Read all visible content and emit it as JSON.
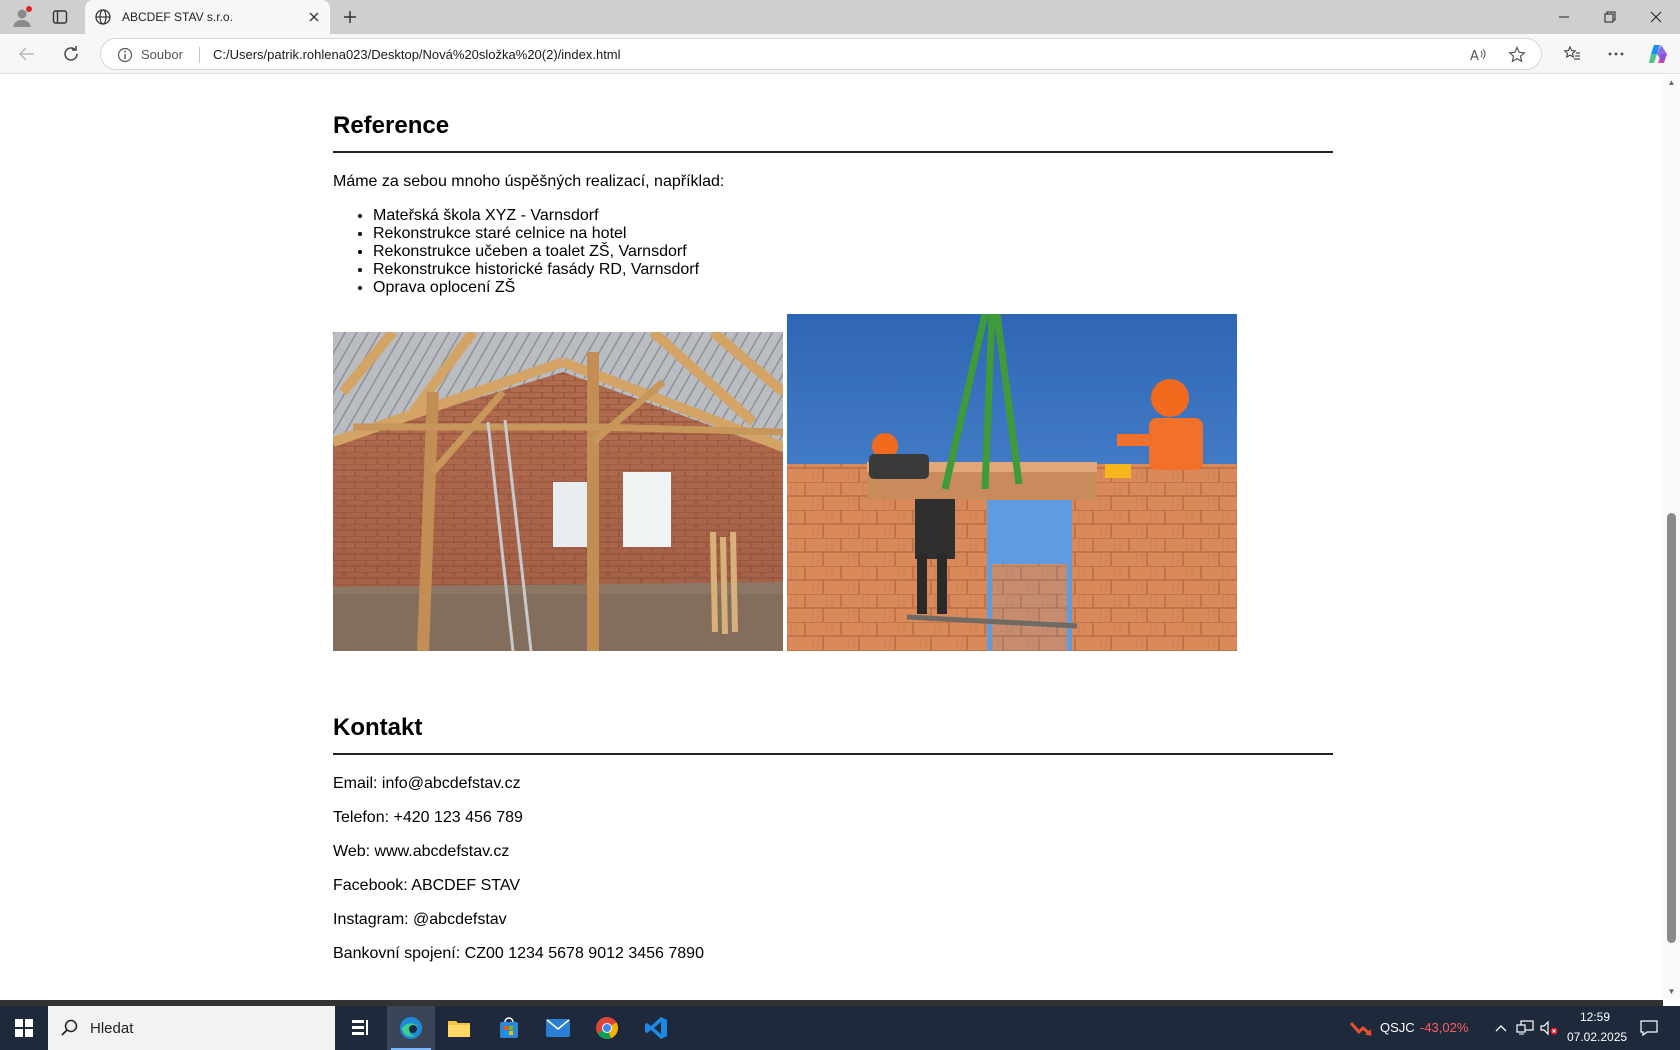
{
  "browser": {
    "tab_title": "ABCDEF STAV s.r.o.",
    "address_label": "Soubor",
    "url": "C:/Users/patrik.rohlena023/Desktop/Nová%20složka%20(2)/index.html"
  },
  "page": {
    "reference": {
      "heading": "Reference",
      "intro": "Máme za sebou mnoho úspěšných realizací, například:",
      "items": [
        "Mateřská škola XYZ - Varnsdorf",
        "Rekonstrukce staré celnice na hotel",
        "Rekonstrukce učeben a toalet ZŠ, Varnsdorf",
        "Rekonstrukce historické fasády RD, Varnsdorf",
        "Oprava oplocení ZŠ"
      ]
    },
    "kontakt": {
      "heading": "Kontakt",
      "lines": [
        "Email: info@abcdefstav.cz",
        "Telefon: +420 123 456 789",
        "Web: www.abcdefstav.cz",
        "Facebook: ABCDEF STAV",
        "Instagram: @abcdefstav",
        "Bankovní spojení: CZ00 1234 5678 9012 3456 7890"
      ]
    }
  },
  "taskbar": {
    "search_placeholder": "Hledat",
    "stock_ticker": "QSJC",
    "stock_change": "-43,02%",
    "time": "12:59",
    "date": "07.02.2025",
    "colors": {
      "stock_down": "#ff5c5c",
      "taskbar_bg": "#1e2a3b"
    }
  }
}
